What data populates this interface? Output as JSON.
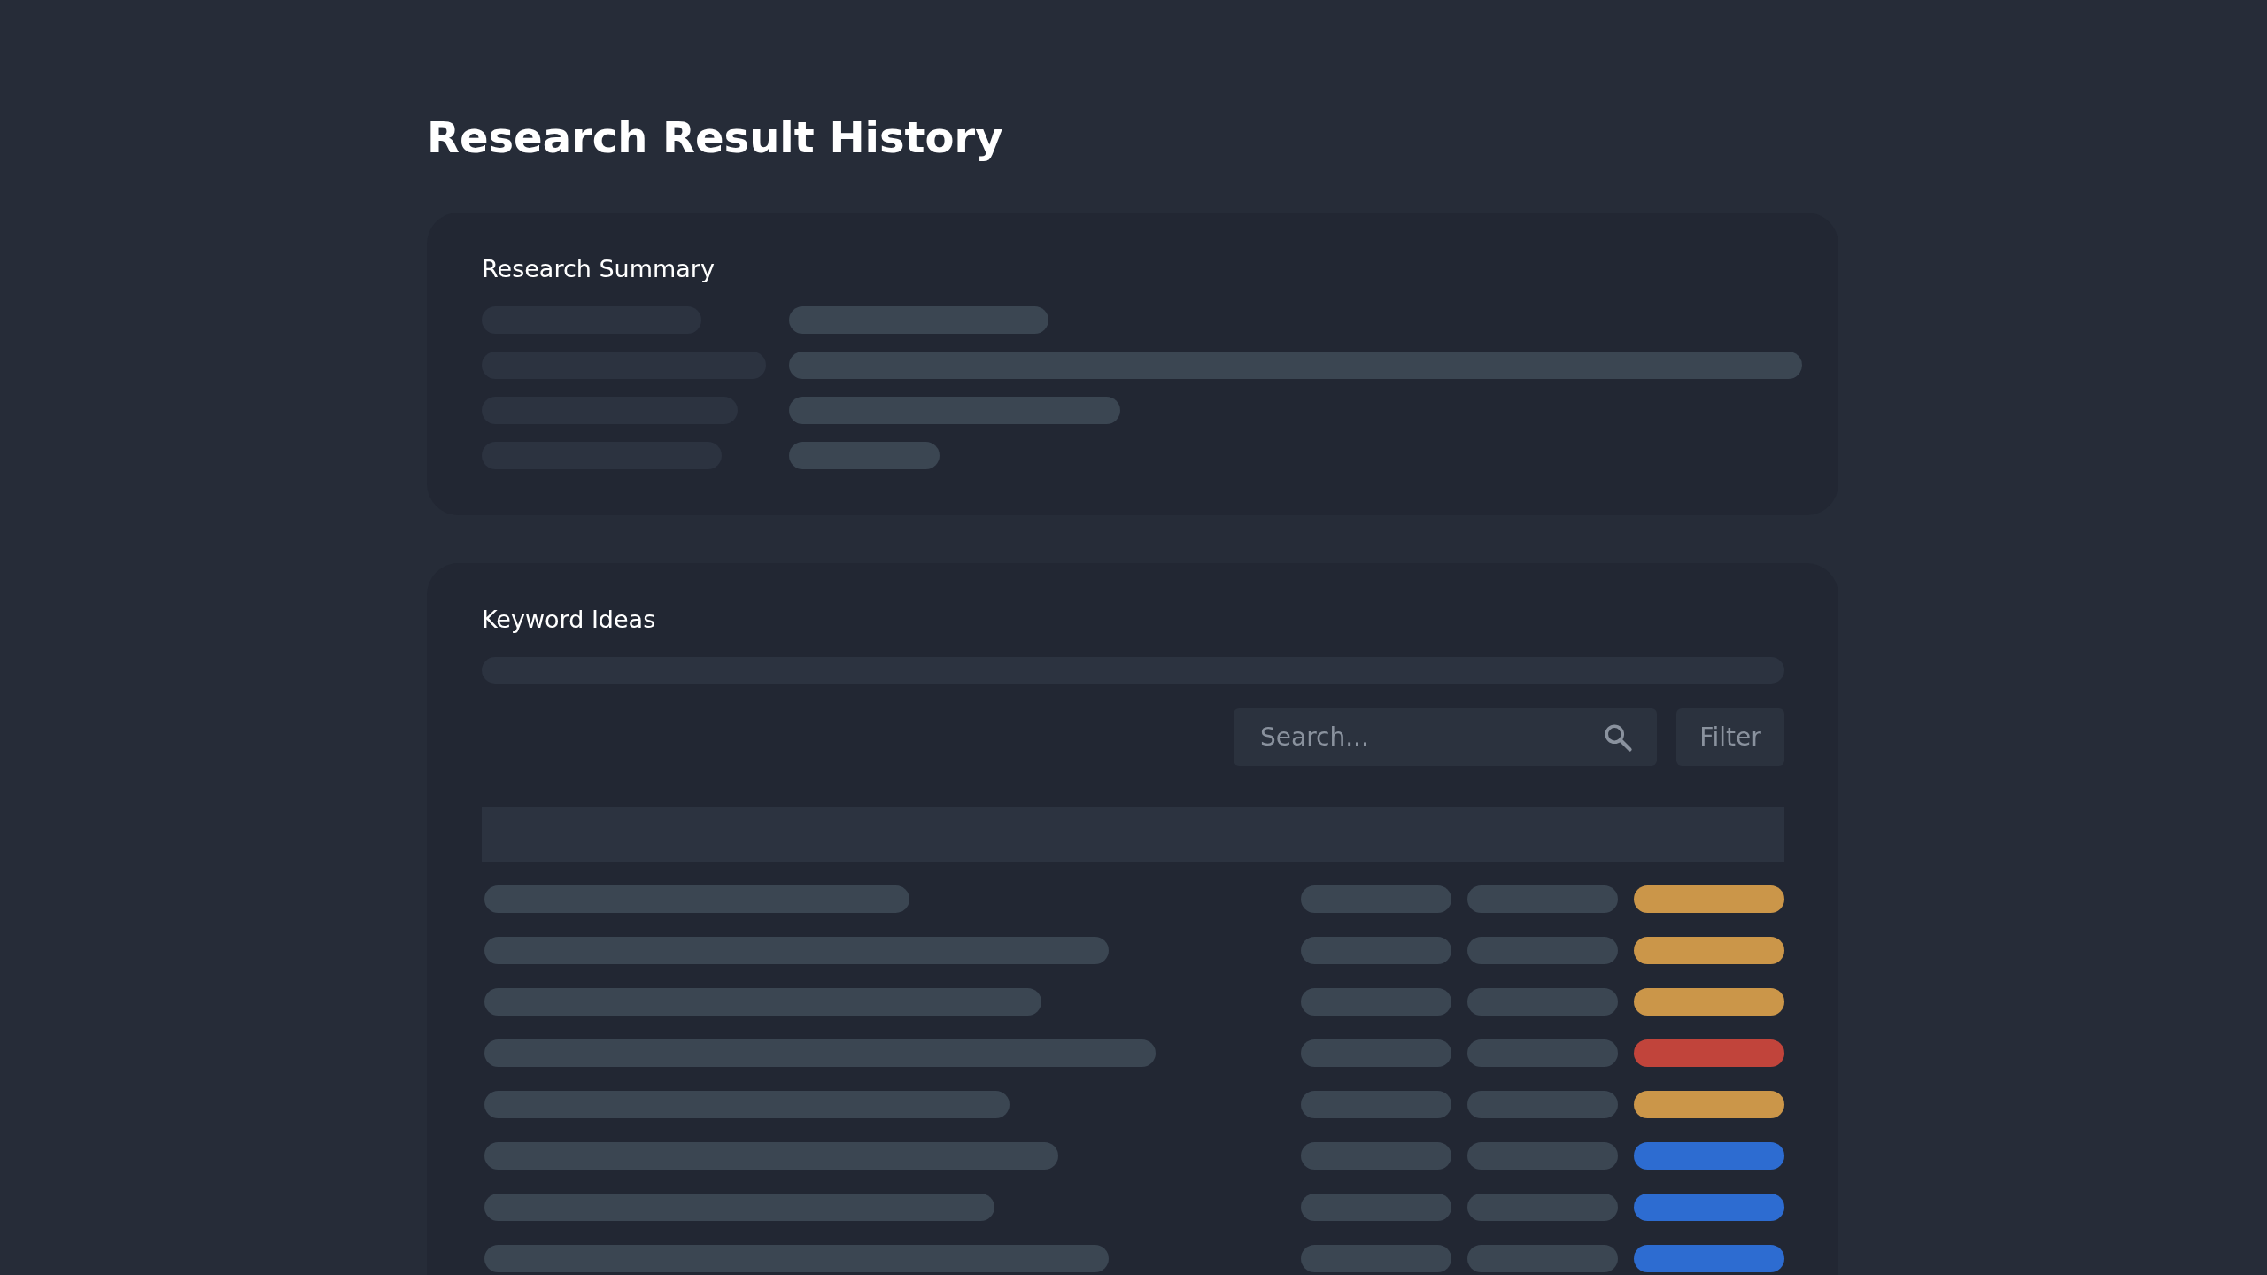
{
  "page": {
    "title": "Research Result History"
  },
  "summary": {
    "title": "Research Summary"
  },
  "keywords": {
    "title": "Keyword Ideas",
    "search": {
      "placeholder": "Search..."
    },
    "filter_button": "Filter",
    "rows": [
      {
        "color": "#cb9649"
      },
      {
        "color": "#cb9649"
      },
      {
        "color": "#cb9649"
      },
      {
        "color": "#c1443b"
      },
      {
        "color": "#cb9649"
      },
      {
        "color": "#2d6cd1"
      },
      {
        "color": "#2d6cd1"
      },
      {
        "color": "#2d6cd1"
      }
    ]
  }
}
